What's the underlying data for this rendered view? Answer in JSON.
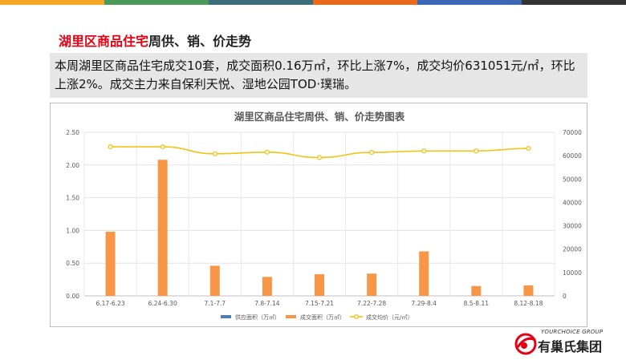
{
  "header": {
    "title_highlight": "湖里区商品住宅",
    "title_rest": "周供、销、价走势"
  },
  "summary": {
    "text": "本周湖里区商品住宅成交10套，成交面积0.16万㎡，环比上涨7%，成交均价631051元/㎡，环比上涨2%。成交主力来自保利天悦、湿地公园TOD·璞瑞。"
  },
  "top_bar_colors": [
    "#f5a623",
    "#4c9a5a",
    "#3d6f7a",
    "#e86a1a",
    "#3a68b5",
    "#333333"
  ],
  "chart_data": {
    "type": "bar",
    "title": "湖里区商品住宅周供、销、价走势图表",
    "categories": [
      "6.17-6.23",
      "6.24-6.30",
      "7.1-7.7",
      "7.8-7.14",
      "7.15-7.21",
      "7.22-7.28",
      "7.29-8.4",
      "8.5-8.11",
      "8.12-8.18"
    ],
    "series": [
      {
        "name": "供应面积（万㎡）",
        "type": "bar",
        "axis": "left",
        "color": "#4a7ebb",
        "values": [
          0,
          0,
          0,
          0,
          0,
          0,
          0,
          0,
          0
        ]
      },
      {
        "name": "成交面积（万㎡）",
        "type": "bar",
        "axis": "left",
        "color": "#f79646",
        "values": [
          0.98,
          2.08,
          0.46,
          0.29,
          0.33,
          0.34,
          0.68,
          0.15,
          0.16
        ]
      },
      {
        "name": "成交均价（元/㎡）",
        "type": "line",
        "axis": "right",
        "color": "#f2c314",
        "values": [
          63800,
          63800,
          60800,
          61500,
          59200,
          61400,
          62000,
          62000,
          63100
        ]
      }
    ],
    "y_left": {
      "min": 0,
      "max": 2.5,
      "ticks": [
        "0.00",
        "0.50",
        "1.00",
        "1.50",
        "2.00",
        "2.50"
      ]
    },
    "y_right": {
      "min": 0,
      "max": 70000,
      "ticks": [
        "0",
        "10000",
        "20000",
        "30000",
        "40000",
        "50000",
        "60000",
        "70000"
      ]
    },
    "grid": true,
    "legend": "bottom"
  },
  "logo": {
    "en": "YOURCHOICE GROUP",
    "cn": "有巢氏集团",
    "color": "#e60012"
  }
}
